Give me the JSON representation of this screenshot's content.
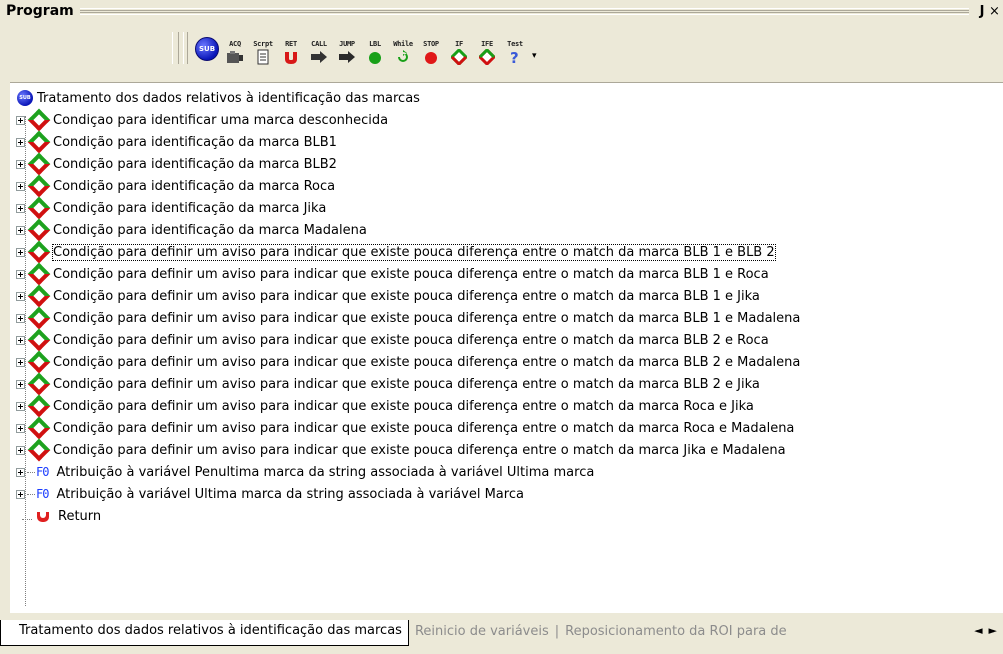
{
  "panel": {
    "title": "Program",
    "pin_glyph": "↓",
    "close_glyph": "×"
  },
  "toolbar": {
    "sub_icon_text": "SUB",
    "buttons": [
      {
        "label": "ACQ",
        "icon": "camera-icon"
      },
      {
        "label": "Scrpt",
        "icon": "script-icon"
      },
      {
        "label": "RET",
        "icon": "return-icon"
      },
      {
        "label": "CALL",
        "icon": "call-arrow-icon"
      },
      {
        "label": "JUMP",
        "icon": "jump-arrow-icon"
      },
      {
        "label": "LBL",
        "icon": "label-dot-icon"
      },
      {
        "label": "While",
        "icon": "loop-icon"
      },
      {
        "label": "STOP",
        "icon": "stop-icon"
      },
      {
        "label": "IF",
        "icon": "if-diamond-icon"
      },
      {
        "label": "IFE",
        "icon": "ife-diamond-icon"
      },
      {
        "label": "Test",
        "icon": "question-icon"
      }
    ],
    "dropdown_glyph": "▾"
  },
  "tree": {
    "root": {
      "icon_text": "SUB",
      "label": "Tratamento dos dados relativos à identificação das marcas"
    },
    "conditions": [
      "Condiçao para identificar uma marca desconhecida",
      "Condição para identificação da marca BLB1",
      "Condição para identificação da marca BLB2",
      "Condição para identificação da marca Roca",
      "Condição para identificação da marca Jika",
      "Condição para identificação da marca Madalena",
      "Condição para definir um aviso para indicar que existe pouca diferença entre o match da marca BLB 1 e BLB 2",
      "Condição para definir um aviso para indicar que existe pouca diferença entre o match da marca BLB 1 e Roca",
      "Condição para definir um aviso para indicar que existe pouca diferença entre o match da marca BLB 1 e Jika",
      "Condição para definir um aviso para indicar que existe pouca diferença entre o match da marca BLB 1 e Madalena",
      "Condição para definir um aviso para indicar que existe pouca diferença entre o match da marca BLB 2 e Roca",
      "Condição para definir um aviso para indicar que existe pouca diferença entre o match da marca BLB 2 e Madalena",
      "Condição para definir um aviso para indicar que existe pouca diferença entre o match da marca BLB 2 e Jika",
      "Condição para definir um aviso para indicar que existe pouca diferença entre o match da marca Roca e Jika",
      "Condição para definir um aviso para indicar que existe pouca diferença entre o match da marca Roca e Madalena",
      "Condição para definir um aviso para indicar que existe pouca diferença entre o match da marca Jika e Madalena"
    ],
    "assignments": [
      {
        "icon_text": "F0",
        "label": "Atribuição à variável Penultima marca da string associada à variável Ultima marca"
      },
      {
        "icon_text": "F0",
        "label": "Atribuição à variável Ultima marca da string associada à variável Marca"
      }
    ],
    "return_label": "Return",
    "focused_index": 6
  },
  "tabs": {
    "active": "Tratamento dos dados relativos à identificação das marcas",
    "others": [
      "Reinicio de variáveis",
      "Reposicionamento da ROI para de"
    ],
    "separator": "|",
    "prev_glyph": "◄",
    "next_glyph": "►"
  }
}
